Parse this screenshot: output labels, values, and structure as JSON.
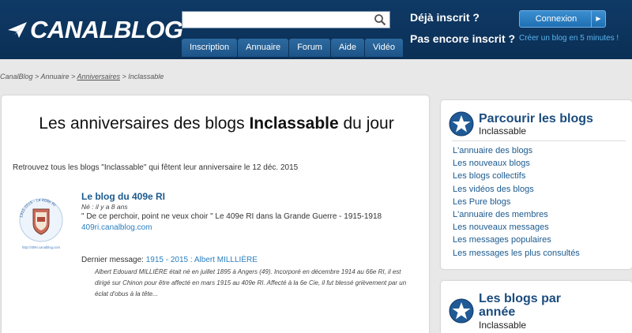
{
  "header": {
    "logo_text": "CANALBLOG",
    "search_value": "",
    "nav": [
      "Inscription",
      "Annuaire",
      "Forum",
      "Aide",
      "Vidéo"
    ],
    "already_registered": "Déjà inscrit ?",
    "not_registered": "Pas encore inscrit ?",
    "login_button": "Connexion",
    "create_blog_link": "Créer un blog en 5 minutes !"
  },
  "breadcrumb": {
    "home": "CanalBlog",
    "sep1": " > ",
    "directory": "Annuaire",
    "sep2": " > ",
    "anniversaries": "Anniversaires",
    "sep3": " > ",
    "current": "Inclassable"
  },
  "main": {
    "title_pre": "Les anniversaires des blogs ",
    "title_bold": "Inclassable",
    "title_post": " du jour",
    "intro": "Retrouvez tous les blogs \"Inclassable\" qui fêtent leur anniversaire le 12 déc. 2015",
    "blog": {
      "name": "Le blog du 409e RI",
      "age": "Né : il y a 8 ans",
      "description": "\" De ce perchoir, point ne veux choir \" Le 409e RI dans la Grande Guerre - 1915-1918",
      "url": "409ri.canalblog.com",
      "last_message_label": "Dernier message: ",
      "last_message_title": "1915 - 2015 : Albert MILLLIÈRE",
      "excerpt": "Albert Edouard MILLIÈRE était né en juillet 1895 à Angers (49). Incorporé en décembre 1914 au 66e RI, il est dirigé sur Chinon pour être affecté en mars 1915 au 409e RI. Affecté à la 6e Cie, il fut blessé grièvement par un éclat d'obus à la tête...",
      "thumb_text_top": "1915-2015 - Le 409e RI",
      "thumb_text_bottom": "http://409ri.canalblog.com"
    }
  },
  "sidebar": {
    "browse_title": "Parcourir les blogs",
    "browse_sub": "Inclassable",
    "links": [
      "L'annuaire des blogs",
      "Les nouveaux blogs",
      "Les blogs collectifs",
      "Les vidéos des blogs",
      "Les Pure blogs",
      "L'annuaire des membres",
      "Les nouveaux messages",
      "Les messages populaires",
      "Les messages les plus consultés"
    ],
    "year_title": "Les blogs par année",
    "year_sub": "Inclassable"
  },
  "colors": {
    "header_bg": "#0f3a66",
    "link_blue": "#1b5a8e",
    "accent_blue": "#2a7fc0"
  }
}
